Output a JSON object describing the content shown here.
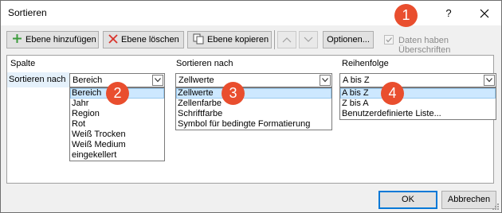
{
  "window": {
    "title": "Sortieren",
    "help_label": "?"
  },
  "toolbar": {
    "add_level": "Ebene hinzufügen",
    "delete_level": "Ebene löschen",
    "copy_level": "Ebene kopieren",
    "options": "Optionen...",
    "has_headers_label": "Daten haben Überschriften",
    "has_headers_checked": true
  },
  "grid": {
    "headers": {
      "column": "Spalte",
      "sort_on": "Sortieren nach",
      "order": "Reihenfolge"
    },
    "row": {
      "label": "Sortieren nach",
      "column_value": "Bereich",
      "sort_on_value": "Zellwerte",
      "order_value": "A bis Z"
    }
  },
  "dropdowns": {
    "column_options": [
      "Bereich",
      "Jahr",
      "Region",
      "Rot",
      "Weiß Trocken",
      "Weiß Medium",
      "eingekellert"
    ],
    "sort_on_options": [
      "Zellwerte",
      "Zellenfarbe",
      "Schriftfarbe",
      "Symbol für bedingte Formatierung"
    ],
    "order_options": [
      "A bis Z",
      "Z bis A",
      "Benutzerdefinierte Liste..."
    ]
  },
  "callouts": [
    "1",
    "2",
    "3",
    "4"
  ],
  "buttons": {
    "ok": "OK",
    "cancel": "Abbrechen"
  },
  "colors": {
    "callout": "#e94e2e",
    "selection": "#cde8ff",
    "accent": "#0078d7"
  }
}
